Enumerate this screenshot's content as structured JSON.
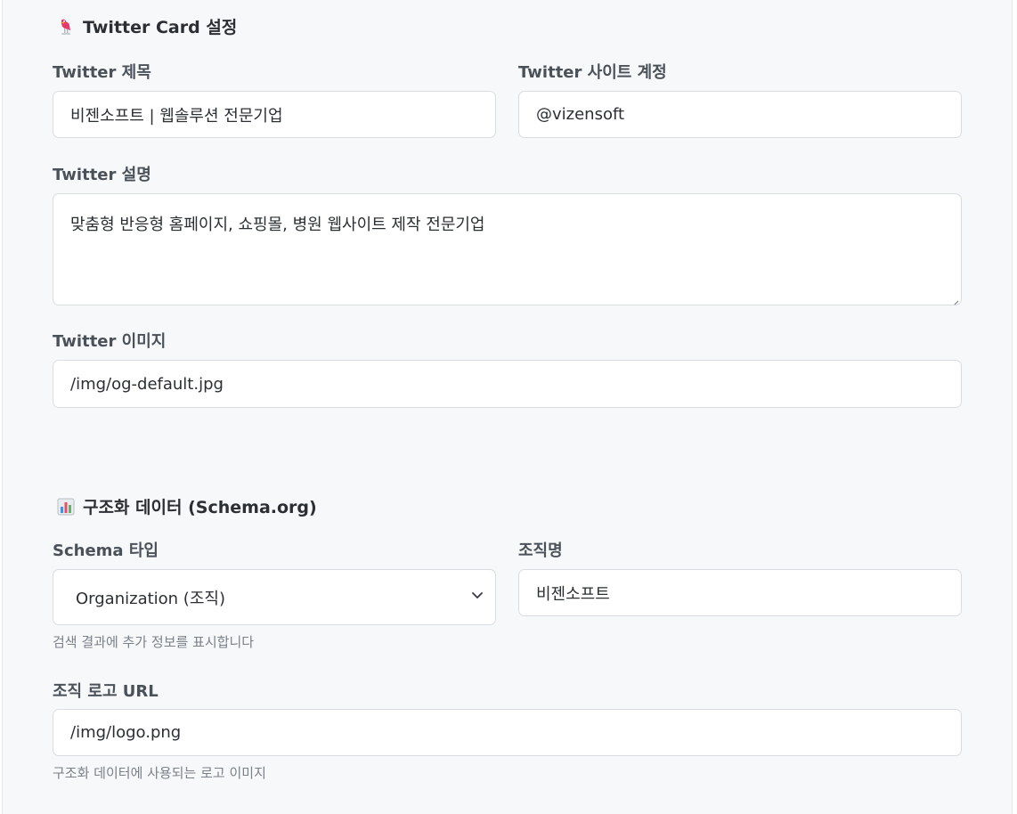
{
  "twitter_section": {
    "icon": "bird-icon",
    "title": "Twitter Card 설정",
    "title_label": "Twitter 제목",
    "title_value": "비젠소프트 | 웹솔루션 전문기업",
    "site_label": "Twitter 사이트 계정",
    "site_value": "@vizensoft",
    "description_label": "Twitter 설명",
    "description_value": "맞춤형 반응형 홈페이지, 쇼핑몰, 병원 웹사이트 제작 전문기업",
    "image_label": "Twitter 이미지",
    "image_value": "/img/og-default.jpg"
  },
  "schema_section": {
    "icon": "bar-chart-icon",
    "title": "구조화 데이터 (Schema.org)",
    "type_label": "Schema 타입",
    "type_value": "Organization (조직)",
    "type_help": "검색 결과에 추가 정보를 표시합니다",
    "org_name_label": "조직명",
    "org_name_value": "비젠소프트",
    "logo_label": "조직 로고 URL",
    "logo_value": "/img/logo.png",
    "logo_help": "구조화 데이터에 사용되는 로고 이미지"
  }
}
